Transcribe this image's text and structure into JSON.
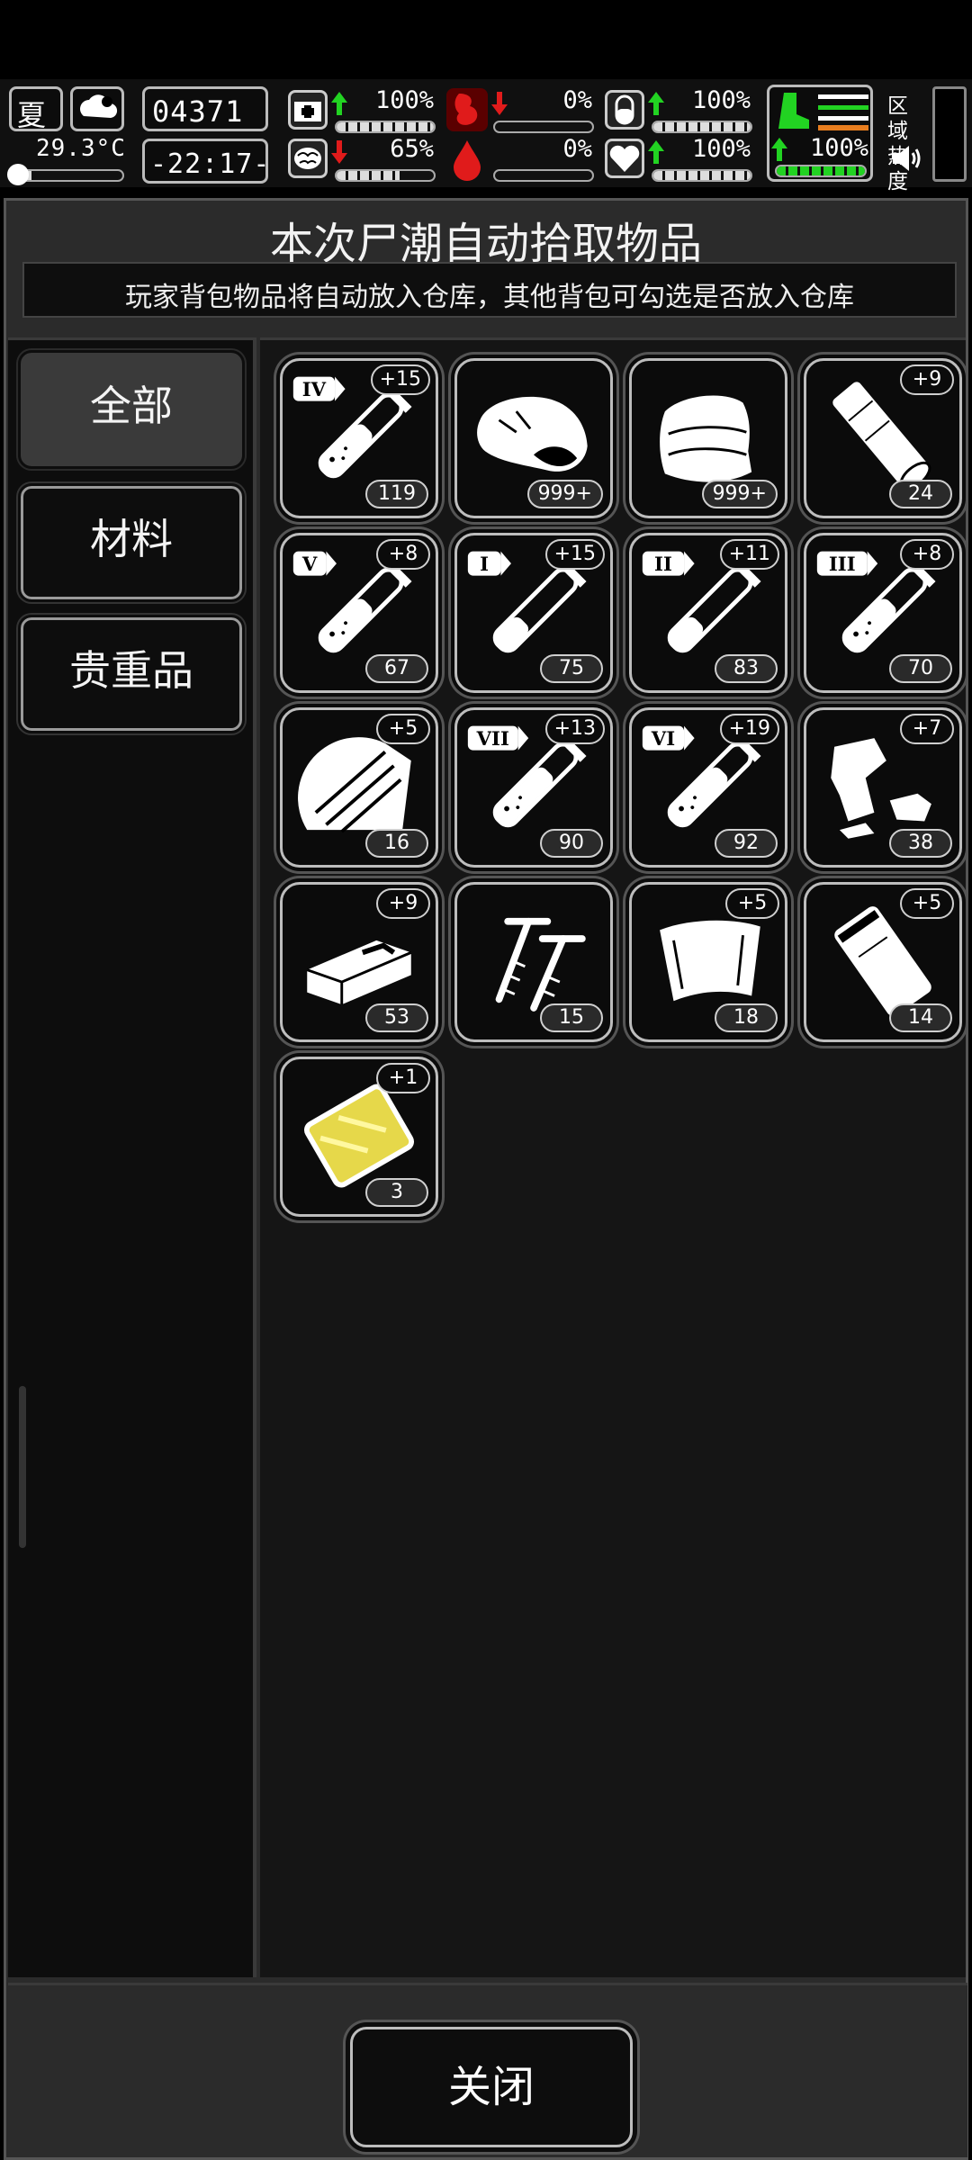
{
  "status": {
    "season": "夏",
    "temperature": "29.3°C",
    "day_counter": "04371",
    "clock": "-22:17-",
    "region_heat_label": "区域\n热度",
    "stats": [
      {
        "name": "health",
        "percent": "100%",
        "trend": "up"
      },
      {
        "name": "hunger",
        "percent": "0%",
        "trend": "down"
      },
      {
        "name": "water",
        "percent": "100%",
        "trend": "up"
      },
      {
        "name": "sanity",
        "percent": "65%",
        "trend": "down"
      },
      {
        "name": "bleeding",
        "percent": "0%",
        "trend": "none"
      },
      {
        "name": "mood",
        "percent": "100%",
        "trend": "up"
      },
      {
        "name": "stamina",
        "percent": "100%",
        "trend": "up"
      }
    ]
  },
  "panel": {
    "title": "本次尸潮自动拾取物品",
    "subtitle": "玩家背包物品将自动放入仓库，其他背包可勾选是否放入仓库"
  },
  "tabs": [
    {
      "label": "全部",
      "active": true
    },
    {
      "label": "材料",
      "active": false
    },
    {
      "label": "贵重品",
      "active": false
    }
  ],
  "items": [
    {
      "icon": "serum-iv-icon",
      "tier": "IV",
      "bonus": "+15",
      "count": "119"
    },
    {
      "icon": "meat-icon",
      "tier": "",
      "bonus": "",
      "count": "999+"
    },
    {
      "icon": "cloth-icon",
      "tier": "",
      "bonus": "",
      "count": "999+"
    },
    {
      "icon": "bandage-roll-icon",
      "tier": "",
      "bonus": "+9",
      "count": "24"
    },
    {
      "icon": "serum-v-icon",
      "tier": "V",
      "bonus": "+8",
      "count": "67"
    },
    {
      "icon": "serum-i-icon",
      "tier": "I",
      "bonus": "+15",
      "count": "75"
    },
    {
      "icon": "serum-ii-icon",
      "tier": "II",
      "bonus": "+11",
      "count": "83"
    },
    {
      "icon": "serum-iii-icon",
      "tier": "III",
      "bonus": "+8",
      "count": "70"
    },
    {
      "icon": "wood-icon",
      "tier": "",
      "bonus": "+5",
      "count": "16"
    },
    {
      "icon": "serum-vii-icon",
      "tier": "VII",
      "bonus": "+13",
      "count": "90"
    },
    {
      "icon": "serum-vi-icon",
      "tier": "VI",
      "bonus": "+19",
      "count": "92"
    },
    {
      "icon": "scrap-metal-icon",
      "tier": "",
      "bonus": "+7",
      "count": "38"
    },
    {
      "icon": "brick-icon",
      "tier": "",
      "bonus": "+9",
      "count": "53"
    },
    {
      "icon": "screws-icon",
      "tier": "",
      "bonus": "",
      "count": "15"
    },
    {
      "icon": "plastic-sheet-icon",
      "tier": "",
      "bonus": "+5",
      "count": "18"
    },
    {
      "icon": "plastic-bag-icon",
      "tier": "",
      "bonus": "+5",
      "count": "14"
    },
    {
      "icon": "gold-plate-icon",
      "tier": "",
      "bonus": "+1",
      "count": "3"
    }
  ],
  "footer": {
    "close_label": "关闭"
  },
  "colors": {
    "panel_bg": "#2b2b2b",
    "grid_bg": "#151515",
    "stat_up": "#22d322",
    "stat_down": "#e01b1b",
    "gold": "#e6d84a"
  }
}
